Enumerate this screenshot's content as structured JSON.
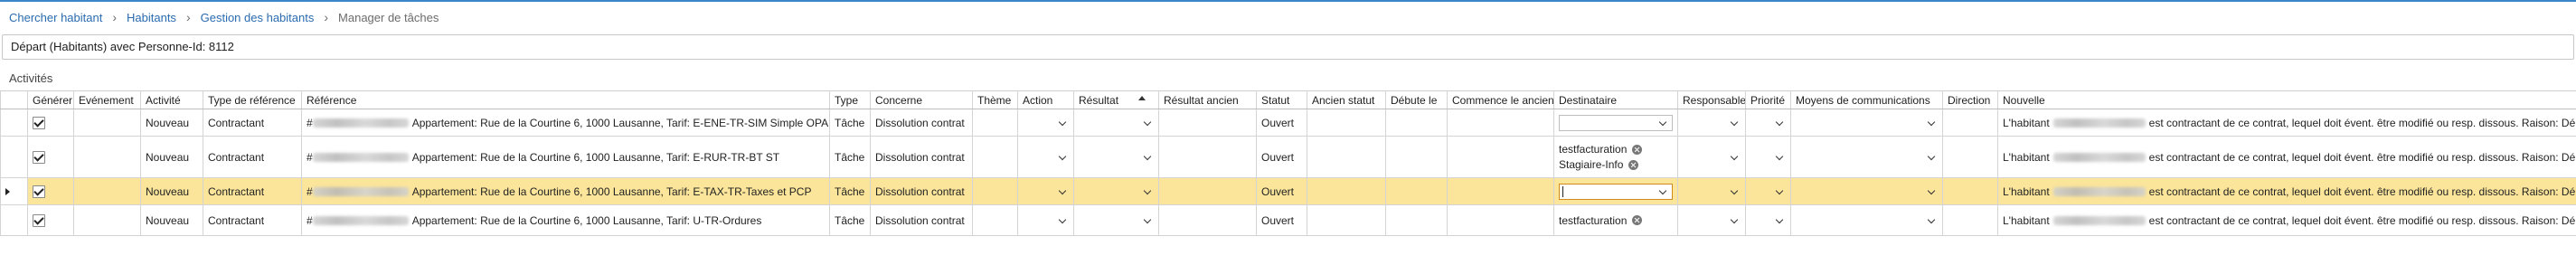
{
  "breadcrumb": {
    "items": [
      "Chercher habitant",
      "Habitants",
      "Gestion des habitants"
    ],
    "current": "Manager de tâches"
  },
  "title": "Départ (Habitants) avec Personne-Id: 8112",
  "section_label": "Activités",
  "grid": {
    "columns": {
      "generer": "Générer",
      "evenement": "Evénement",
      "activite": "Activité",
      "type_reference": "Type de référence",
      "reference": "Référence",
      "type": "Type",
      "concerne": "Concerne",
      "theme": "Thème",
      "action": "Action",
      "resultat": "Résultat",
      "resultat_ancien": "Résultat ancien",
      "statut": "Statut",
      "ancien_statut": "Ancien statut",
      "debute_le": "Débute le",
      "commence_le_ancien": "Commence le ancien",
      "destinataire": "Destinataire",
      "responsable": "Responsable",
      "priorite": "Priorité",
      "moyens_communications": "Moyens de communications",
      "direction": "Direction",
      "nouvelle": "Nouvelle"
    },
    "sorted_column": "resultat",
    "rows": [
      {
        "selected": false,
        "generer": true,
        "activite": "Nouveau",
        "type_reference": "Contractant",
        "reference_prefix": "#",
        "reference": "Appartement: Rue de la Courtine 6, 1000 Lausanne, Tarif: E-ENE-TR-SIM Simple OPALE",
        "type": "Tâche",
        "concerne": "Dissolution contrat",
        "statut": "Ouvert",
        "destinataires": [],
        "nouvelle_prefix": "L'habitant",
        "nouvelle": "est contractant de ce contrat, lequel doit évent. être modifié ou resp. dissous. Raison: Départ"
      },
      {
        "selected": false,
        "generer": true,
        "activite": "Nouveau",
        "type_reference": "Contractant",
        "reference_prefix": "#",
        "reference": "Appartement: Rue de la Courtine 6, 1000 Lausanne, Tarif: E-RUR-TR-BT ST",
        "type": "Tâche",
        "concerne": "Dissolution contrat",
        "statut": "Ouvert",
        "destinataires": [
          "testfacturation",
          "Stagiaire-Info"
        ],
        "nouvelle_prefix": "L'habitant",
        "nouvelle": "est contractant de ce contrat, lequel doit évent. être modifié ou resp. dissous. Raison: Départ"
      },
      {
        "selected": true,
        "generer": true,
        "activite": "Nouveau",
        "type_reference": "Contractant",
        "reference_prefix": "#",
        "reference": "Appartement: Rue de la Courtine 6, 1000 Lausanne, Tarif: E-TAX-TR-Taxes et PCP",
        "type": "Tâche",
        "concerne": "Dissolution contrat",
        "statut": "Ouvert",
        "destinataires": [],
        "nouvelle_prefix": "L'habitant",
        "nouvelle": "est contractant de ce contrat, lequel doit évent. être modifié ou resp. dissous. Raison: Départ"
      },
      {
        "selected": false,
        "generer": true,
        "activite": "Nouveau",
        "type_reference": "Contractant",
        "reference_prefix": "#",
        "reference": "Appartement: Rue de la Courtine 6, 1000 Lausanne, Tarif: U-TR-Ordures",
        "type": "Tâche",
        "concerne": "Dissolution contrat",
        "statut": "Ouvert",
        "destinataires": [
          "testfacturation"
        ],
        "nouvelle_prefix": "L'habitant",
        "nouvelle": "est contractant de ce contrat, lequel doit évent. être modifié ou resp. dissous. Raison: Départ"
      }
    ]
  },
  "colors": {
    "selected_row": "#fbe59a",
    "link": "#2a6bb0",
    "focus_border": "#d08a1a",
    "top_accent": "#3b86c8"
  }
}
